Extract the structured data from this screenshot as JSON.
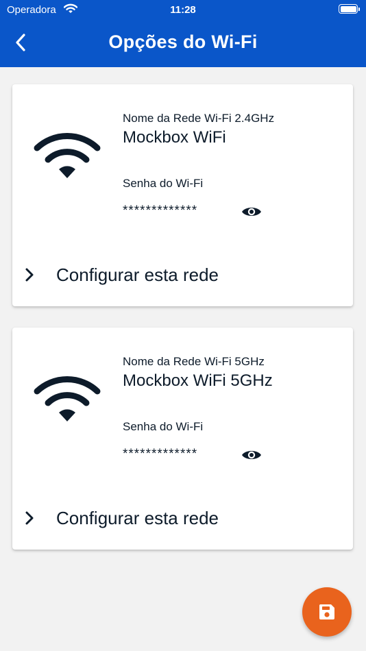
{
  "status_bar": {
    "carrier": "Operadora",
    "time": "11:28"
  },
  "header": {
    "title": "Opções do Wi-Fi",
    "back_icon": "chevron-left-icon",
    "background_color": "#0a56c9"
  },
  "networks": [
    {
      "name_label": "Nome da Rede Wi-Fi 2.4GHz",
      "name": "Mockbox WiFi",
      "password_label": "Senha do Wi-Fi",
      "password_masked": "*************",
      "configure_label": "Configurar esta rede",
      "icon": "wifi-icon"
    },
    {
      "name_label": "Nome da Rede Wi-Fi 5GHz",
      "name": "Mockbox WiFi 5GHz",
      "password_label": "Senha do Wi-Fi",
      "password_masked": "*************",
      "configure_label": "Configurar esta rede",
      "icon": "wifi-icon"
    }
  ],
  "fab": {
    "icon": "save-icon",
    "color": "#e9631d"
  }
}
